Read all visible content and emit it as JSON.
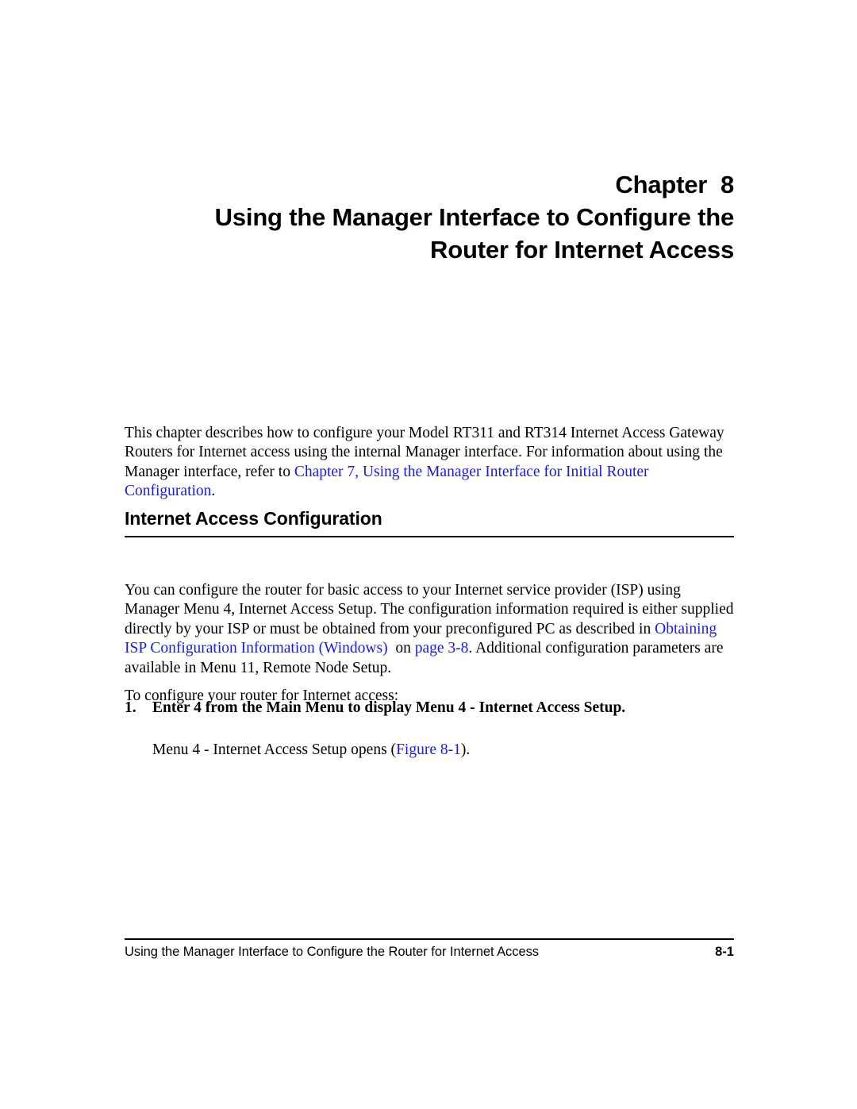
{
  "chapter": {
    "label_line": "Chapter  8",
    "title_line_1": "Using the Manager Interface to Configure the",
    "title_line_2": "Router for Internet Access"
  },
  "intro": {
    "text_1": "This chapter describes how to configure your Model RT311 and RT314 Internet Access Gateway Routers for Internet access using the internal Manager interface. For information about using the Manager interface, refer to ",
    "link_1": "Chapter 7,  Using the Manager Interface for Initial Router Configuration",
    "text_2": "."
  },
  "section": {
    "heading": "Internet Access Configuration"
  },
  "config_para": {
    "text_1": "You can configure the router for basic access to your Internet service provider (ISP) using Manager Menu 4, Internet Access Setup. The configuration information required is either supplied directly by your ISP or must be obtained from your preconfigured PC as described in ",
    "link_1": "Obtaining ISP Configuration Information (Windows) ",
    "text_2": " on ",
    "link_2": "page 3-8",
    "text_3": ". Additional configuration parameters are available in Menu 11, Remote Node Setup."
  },
  "lead_in": {
    "text": "To configure your router for Internet access:"
  },
  "step": {
    "number": "1.",
    "text": "Enter 4 from the Main Menu to display Menu 4 - Internet Access Setup.",
    "sub_text_1": "Menu 4 - Internet Access Setup opens (",
    "sub_link": "Figure 8-1",
    "sub_text_2": ")."
  },
  "footer": {
    "title": "Using the Manager Interface to Configure the Router for Internet Access",
    "page": "8-1"
  },
  "colors": {
    "link": "#1a1ae6",
    "text": "#000000",
    "background": "#ffffff"
  }
}
